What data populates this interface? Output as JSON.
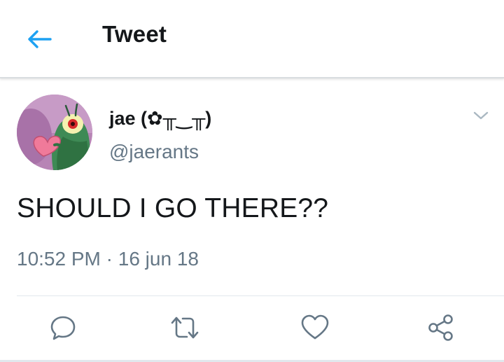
{
  "colors": {
    "accent": "#1da1f2",
    "text_primary": "#14171a",
    "text_secondary": "#657786",
    "divider": "#e1e8ed"
  },
  "header": {
    "title": "Tweet",
    "back_icon": "arrow-left-icon"
  },
  "tweet": {
    "author": {
      "display_name": "jae (✿╥‿╥)",
      "handle": "@jaerants",
      "avatar": "avatar-image"
    },
    "more_icon": "chevron-down-icon",
    "text": "SHOULD I GO THERE??",
    "time": "10:52 PM",
    "separator": "·",
    "date": "16 jun 18",
    "actions": [
      {
        "name": "reply",
        "icon": "reply-icon"
      },
      {
        "name": "retweet",
        "icon": "retweet-icon"
      },
      {
        "name": "like",
        "icon": "heart-icon"
      },
      {
        "name": "share",
        "icon": "share-icon"
      }
    ]
  }
}
